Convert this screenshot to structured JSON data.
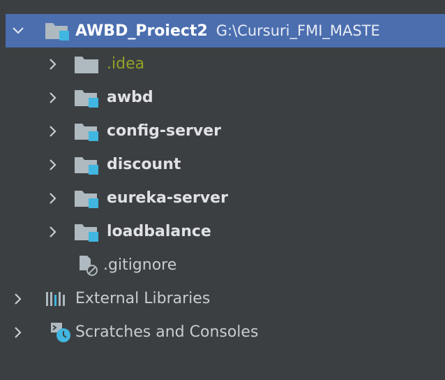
{
  "project_tree": {
    "root": {
      "name": "AWBD_Proiect2",
      "path": "G:\\Cursuri_FMI_MASTE",
      "icon": "module-folder-icon",
      "expanded": true
    },
    "children": [
      {
        "name": ".idea",
        "icon": "folder-icon",
        "expanded": false
      },
      {
        "name": "awbd",
        "icon": "module-folder-icon",
        "expanded": false
      },
      {
        "name": "config-server",
        "icon": "module-folder-icon",
        "expanded": false
      },
      {
        "name": "discount",
        "icon": "module-folder-icon",
        "expanded": false
      },
      {
        "name": "eureka-server",
        "icon": "module-folder-icon",
        "expanded": false
      },
      {
        "name": "loadbalance",
        "icon": "module-folder-icon",
        "expanded": false
      },
      {
        "name": ".gitignore",
        "icon": "ignored-file-icon"
      }
    ],
    "external_libraries": {
      "name": "External Libraries",
      "icon": "libraries-icon",
      "expanded": false
    },
    "scratches": {
      "name": "Scratches and Consoles",
      "icon": "scratches-icon",
      "expanded": false
    }
  },
  "colors": {
    "background": "#3c3f41",
    "selection": "#4b6eaf",
    "folder_gray": "#aeb9c0",
    "module_blue": "#40b6e0",
    "idea_text": "#93a229"
  }
}
